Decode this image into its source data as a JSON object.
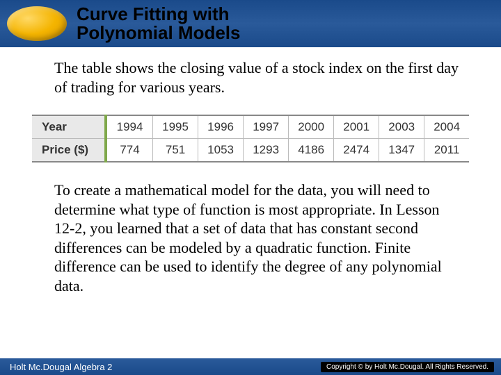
{
  "header": {
    "title_line1": "Curve Fitting with",
    "title_line2": "Polynomial Models"
  },
  "intro": "The table shows the closing value of a stock index on the first day of trading for various years.",
  "chart_data": {
    "type": "table",
    "row_labels": [
      "Year",
      "Price ($)"
    ],
    "columns": [
      "1994",
      "1995",
      "1996",
      "1997",
      "2000",
      "2001",
      "2003",
      "2004"
    ],
    "rows": [
      [
        "1994",
        "1995",
        "1996",
        "1997",
        "2000",
        "2001",
        "2003",
        "2004"
      ],
      [
        "774",
        "751",
        "1053",
        "1293",
        "4186",
        "2474",
        "1347",
        "2011"
      ]
    ]
  },
  "body": "To create a mathematical model for the data, you will need to determine what type of function is most appropriate. In Lesson 12-2, you learned that a set of data that has constant second differences can be modeled by a quadratic function. Finite difference can be used to identify the degree of any polynomial data.",
  "footer": {
    "left": "Holt Mc.Dougal Algebra 2",
    "right": "Copyright © by Holt Mc.Dougal. All Rights Reserved."
  }
}
